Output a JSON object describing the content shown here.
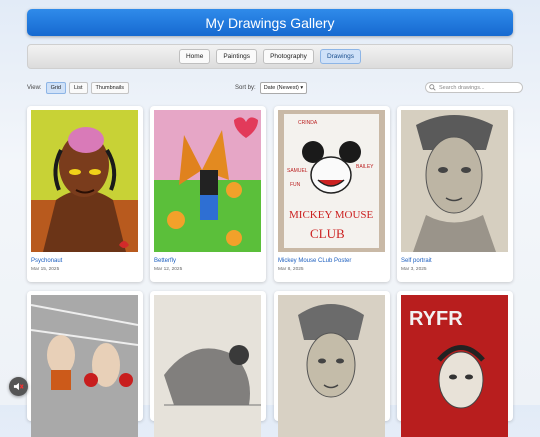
{
  "header": {
    "title": "My Drawings Gallery"
  },
  "nav": {
    "items": [
      "Home",
      "Paintings",
      "Photography",
      "Drawings"
    ],
    "active": "Drawings"
  },
  "toolbar": {
    "view_label": "View:",
    "view_options": [
      "Grid",
      "List",
      "Thumbnails"
    ],
    "view_active": "Grid",
    "sort_label": "Sort by:",
    "sort_value": "Date (Newest)",
    "search_placeholder": "Search drawings..."
  },
  "cards": [
    {
      "title": "Psychonaut",
      "date": "Mar 15, 2025"
    },
    {
      "title": "Betterfly",
      "date": "Mar 12, 2025"
    },
    {
      "title": "Mickey Mouse CLub Poster",
      "date": "Mar 8, 2025"
    },
    {
      "title": "Self portrait",
      "date": "Mar 3, 2025"
    },
    {
      "title": "",
      "date": ""
    },
    {
      "title": "",
      "date": ""
    },
    {
      "title": "",
      "date": ""
    },
    {
      "title": "",
      "date": ""
    }
  ],
  "poster_text": {
    "top": "CRINDA",
    "left": "SAMUEL",
    "right": "BAILEY",
    "left2": "FUN",
    "main1": "MICKEY MOUSE",
    "main2": "CLUB"
  },
  "portrait_text": "RYFR",
  "colors": {
    "accent": "#1669d0",
    "link": "#1d5fbf"
  }
}
